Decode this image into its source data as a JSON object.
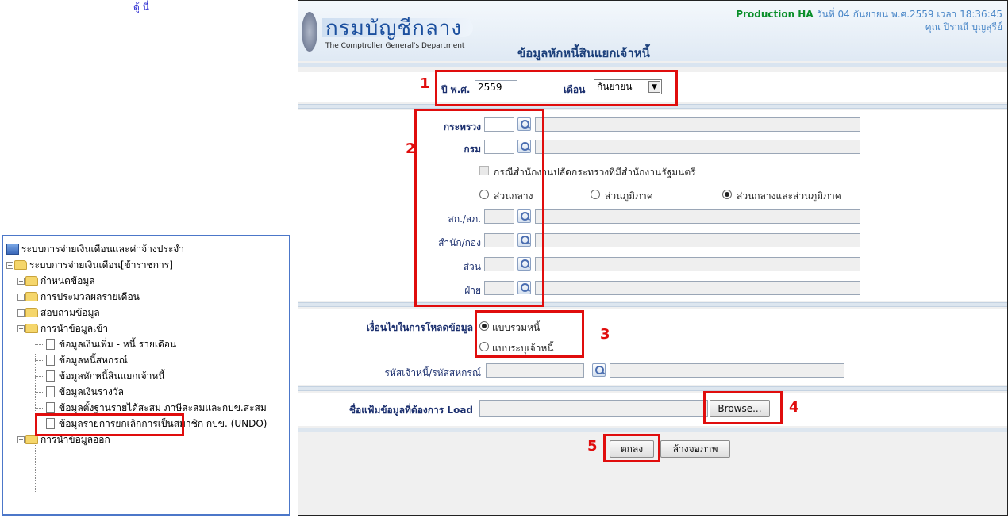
{
  "top_fragment": "ดู้ นี่",
  "tree": {
    "root": "ระบบการจ่ายเงินเดือนและค่าจ้างประจำ",
    "system": "ระบบการจ่ายเงินเดือน[ข้าราชการ]",
    "items": [
      {
        "label": "กำหนดข้อมูล"
      },
      {
        "label": "การประมวลผลรายเดือน"
      },
      {
        "label": "สอบถามข้อมูล"
      },
      {
        "label": "การนำข้อมูลเข้า"
      },
      {
        "label": "ข้อมูลเงินเพิ่ม - หนี้ รายเดือน"
      },
      {
        "label": "ข้อมูลหนี้สหกรณ์"
      },
      {
        "label": "ข้อมูลหักหนี้สินแยกเจ้าหนี้"
      },
      {
        "label": "ข้อมูลเงินรางวัล"
      },
      {
        "label": "ข้อมูลตั้งฐานรายได้สะสม ภาษีสะสมและกบข.สะสม"
      },
      {
        "label": "ข้อมูลรายการยกเลิกการเป็นสมาชิก กบข. (UNDO)"
      },
      {
        "label": "การนำข้อมูลออก"
      }
    ]
  },
  "header": {
    "logo_th": "กรมบัญชีกลาง",
    "logo_en": "The Comptroller General's Department",
    "env": "Production HA",
    "datetime": "วันที่ 04 กันยายน พ.ศ.2559 เวลา 18:36:45",
    "user": "คุณ ปิราณี บุญสุรีย์",
    "title": "ข้อมูลหักหนี้สินแยกเจ้าหนี้"
  },
  "period": {
    "year_label": "ปี พ.ศ.",
    "year_value": "2559",
    "month_label": "เดือน",
    "month_value": "กันยายน"
  },
  "org": {
    "ministry_label": "กระทรวง",
    "dept_label": "กรม",
    "checkbox_label": "กรณีสำนักงานปลัดกระทรวงที่มีสำนักงานรัฐมนตรี",
    "radio_central": "ส่วนกลาง",
    "radio_regional": "ส่วนภูมิภาค",
    "radio_both": "ส่วนกลางและส่วนภูมิภาค",
    "office_label": "สก./สภ.",
    "bureau_label": "สำนัก/กอง",
    "division_label": "ส่วน",
    "section_label": "ฝ่าย"
  },
  "load": {
    "condition_label": "เงื่อนไขในการโหลดข้อมูล",
    "opt_total": "แบบรวมหนี้",
    "opt_creditor": "แบบระบุเจ้าหนี้",
    "creditor_label": "รหัสเจ้าหนี้/รหัสสหกรณ์",
    "file_label": "ชื่อแฟ้มข้อมูลที่ต้องการ Load",
    "browse": "Browse...",
    "ok": "ตกลง",
    "clear": "ล้างจอภาพ"
  },
  "annotations": [
    "1",
    "2",
    "3",
    "4",
    "5"
  ],
  "colors": {
    "annotation": "#e00d0d",
    "env": "#0a8f2a",
    "accent": "#1b4f9e"
  }
}
